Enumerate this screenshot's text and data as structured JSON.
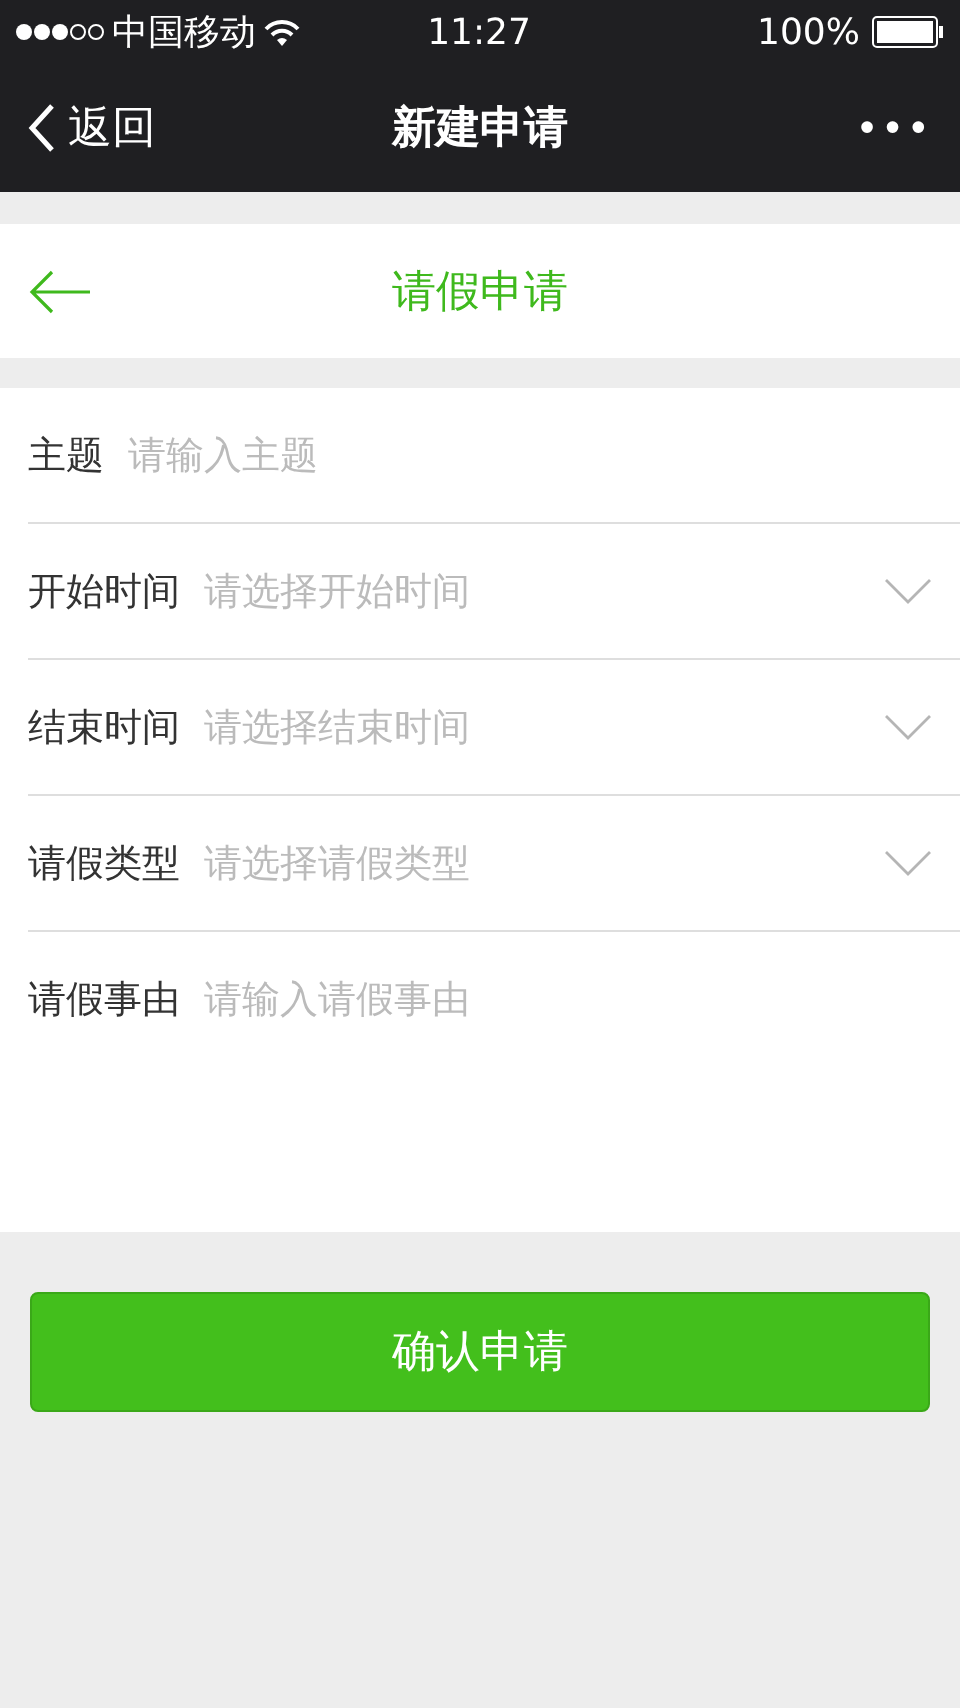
{
  "status_bar": {
    "carrier": "中国移动",
    "time": "11:27",
    "battery": "100%"
  },
  "nav_bar": {
    "back": "返回",
    "title": "新建申请",
    "more": "•••"
  },
  "form_header": {
    "title": "请假申请"
  },
  "fields": [
    {
      "kind": "text",
      "label": "主题",
      "placeholder": "请输入主题"
    },
    {
      "kind": "select",
      "label": "开始时间",
      "placeholder": "请选择开始时间"
    },
    {
      "kind": "select",
      "label": "结束时间",
      "placeholder": "请选择结束时间"
    },
    {
      "kind": "select",
      "label": "请假类型",
      "placeholder": "请选择请假类型"
    },
    {
      "kind": "textarea",
      "label": "请假事由",
      "placeholder": "请输入请假事由"
    }
  ],
  "submit": "确认申请"
}
